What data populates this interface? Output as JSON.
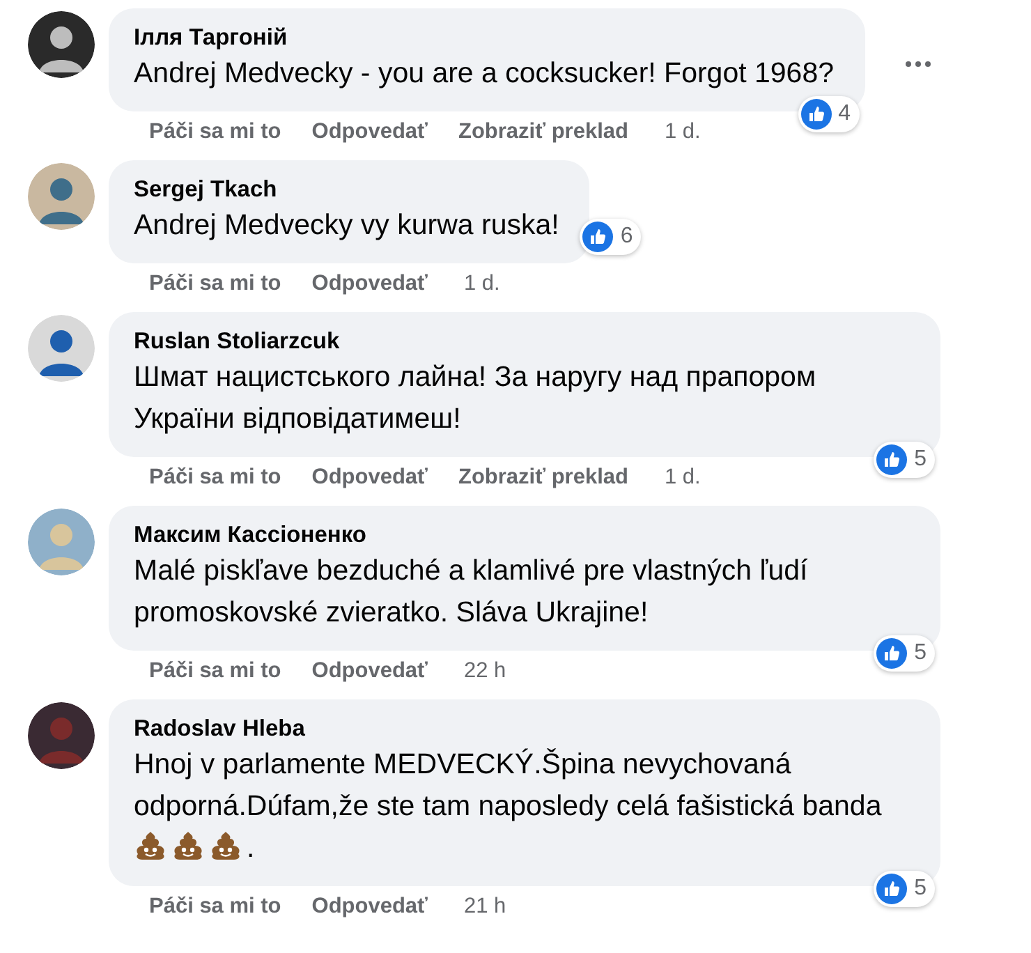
{
  "comments": [
    {
      "author": "Ілля Таргоній",
      "body": "Andrej Medvecky - you are a cocksucker! Forgot 1968?",
      "reactions": {
        "count": "4",
        "inline": false
      },
      "actions": [
        "Páči sa mi to",
        "Odpovedať",
        "Zobraziť preklad"
      ],
      "time": "1 d.",
      "more_button": true
    },
    {
      "author": "Sergej Tkach",
      "body": "Andrej Medvecky vy kurwa ruska!",
      "reactions": {
        "count": "6",
        "inline": true
      },
      "actions": [
        "Páči sa mi to",
        "Odpovedať"
      ],
      "time": "1 d.",
      "more_button": false
    },
    {
      "author": "Ruslan Stoliarzcuk",
      "body": "Шмат нацистського лайна! За наругу над прапором України відповідатимеш!",
      "reactions": {
        "count": "5",
        "inline": false
      },
      "actions": [
        "Páči sa mi to",
        "Odpovedať",
        "Zobraziť preklad"
      ],
      "time": "1 d.",
      "more_button": false
    },
    {
      "author": "Максим Кассіоненко",
      "body": "Malé piskľave bezduché a klamlivé pre vlastných ľudí promoskovské zvieratko. Sláva Ukrajine!",
      "reactions": {
        "count": "5",
        "inline": false
      },
      "actions": [
        "Páči sa mi to",
        "Odpovedať"
      ],
      "time": "22 h",
      "more_button": false
    },
    {
      "author": "Radoslav Hleba",
      "body": "Hnoj v parlamente MEDVECKÝ.Špina nevychovaná odporná.Dúfam,že ste tam naposledy celá fašistická banda",
      "emojis": [
        {
          "kind": "poop"
        },
        {
          "kind": "poop"
        },
        {
          "kind": "poop"
        }
      ],
      "body_end": ".",
      "reactions": {
        "count": "5",
        "inline": false
      },
      "actions": [
        "Páči sa mi to",
        "Odpovedať"
      ],
      "time": "21 h",
      "more_button": false
    }
  ]
}
